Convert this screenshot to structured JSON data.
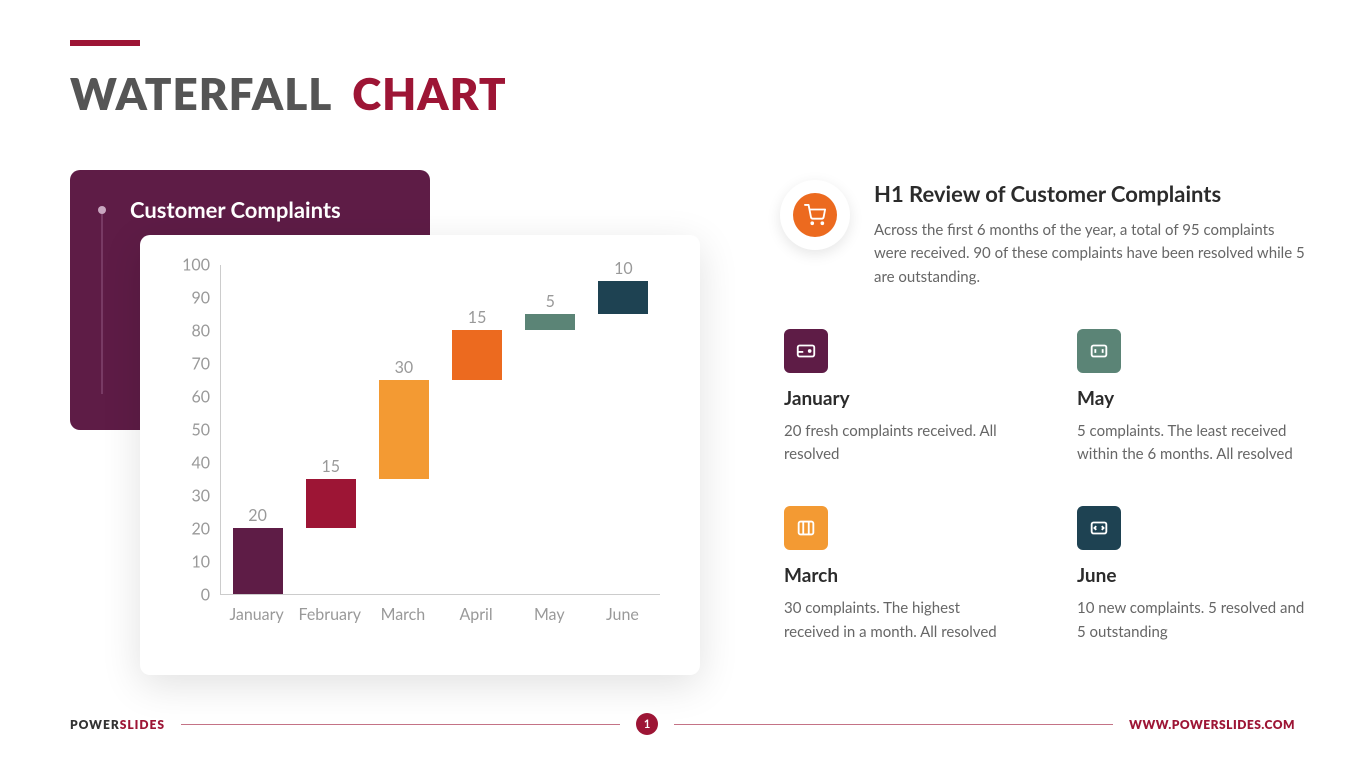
{
  "title": {
    "part1": "WATERFALL",
    "part2": "CHART"
  },
  "chart_caption": "Customer Complaints",
  "chart_data": {
    "type": "bar",
    "subtype": "waterfall",
    "title": "Customer Complaints",
    "ylabel": "",
    "xlabel": "",
    "ylim": [
      0,
      100
    ],
    "yticks": [
      0,
      10,
      20,
      30,
      40,
      50,
      60,
      70,
      80,
      90,
      100
    ],
    "categories": [
      "January",
      "February",
      "March",
      "April",
      "May",
      "June"
    ],
    "values": [
      20,
      15,
      30,
      15,
      5,
      10
    ],
    "bars": [
      {
        "label": "January",
        "value": 20,
        "start": 0,
        "end": 20,
        "color": "#5e1c46"
      },
      {
        "label": "February",
        "value": 15,
        "start": 20,
        "end": 35,
        "color": "#9d1535"
      },
      {
        "label": "March",
        "value": 30,
        "start": 35,
        "end": 65,
        "color": "#f39a33"
      },
      {
        "label": "April",
        "value": 15,
        "start": 65,
        "end": 80,
        "color": "#ec6a1f"
      },
      {
        "label": "May",
        "value": 5,
        "start": 80,
        "end": 85,
        "color": "#5b8476"
      },
      {
        "label": "June",
        "value": 10,
        "start": 85,
        "end": 95,
        "color": "#1e4252"
      }
    ]
  },
  "hero": {
    "title": "H1 Review of Customer Complaints",
    "body": "Across the first 6 months of the year, a total of 95 complaints were received. 90 of these complaints have been resolved while 5 are outstanding."
  },
  "cards": [
    {
      "title": "January",
      "body": "20 fresh complaints received. All resolved",
      "color": "#5e1c46"
    },
    {
      "title": "May",
      "body": "5 complaints. The least received within the 6 months. All resolved",
      "color": "#5b8476"
    },
    {
      "title": "March",
      "body": "30 complaints. The highest received in a month. All resolved",
      "color": "#f39a33"
    },
    {
      "title": "June",
      "body": "10 new complaints. 5 resolved and 5 outstanding",
      "color": "#1e4252"
    }
  ],
  "footer": {
    "brand1": "POWER",
    "brand2": "SLIDES",
    "page": "1",
    "url": "WWW.POWERSLIDES.COM"
  }
}
